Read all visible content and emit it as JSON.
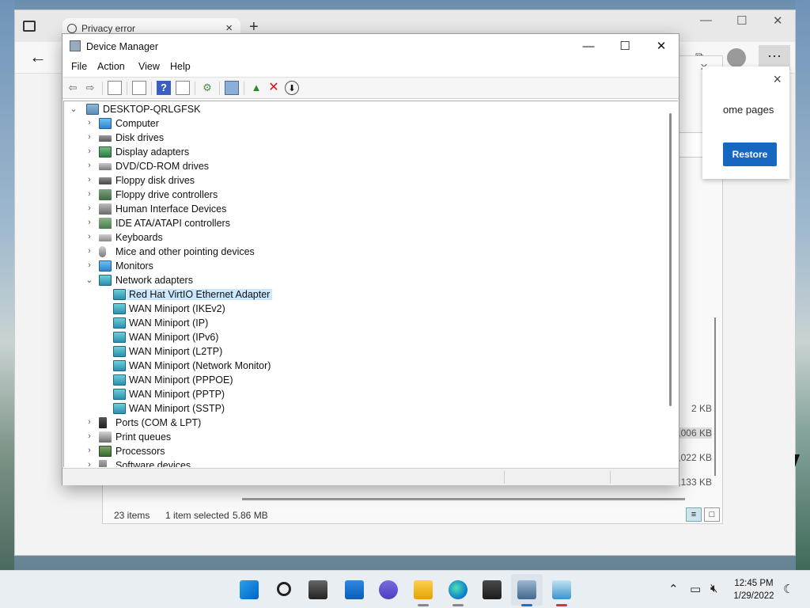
{
  "browser": {
    "tab_title": "Privacy error",
    "tab_close": "×",
    "new_tab": "+",
    "restore_text": "ome pages",
    "restore_button": "Restore",
    "close": "×",
    "more": "···"
  },
  "downloads": {
    "sizes": [
      "2 KB",
      ",006 KB",
      ",022 KB",
      ",133 KB"
    ],
    "status": {
      "items": "23 items",
      "selected": "1 item selected",
      "size": "5.86 MB"
    }
  },
  "device_manager": {
    "title": "Device Manager",
    "controls": {
      "minimize": "—",
      "maximize": "☐",
      "close": "✕"
    },
    "menu": [
      "File",
      "Action",
      "View",
      "Help"
    ],
    "root": "DESKTOP-QRLGFSK",
    "categories": [
      {
        "label": "Computer",
        "icon": "computer-icon"
      },
      {
        "label": "Disk drives",
        "icon": "disk-drive-icon"
      },
      {
        "label": "Display adapters",
        "icon": "display-adapter-icon"
      },
      {
        "label": "DVD/CD-ROM drives",
        "icon": "dvd-drive-icon"
      },
      {
        "label": "Floppy disk drives",
        "icon": "floppy-disk-icon"
      },
      {
        "label": "Floppy drive controllers",
        "icon": "floppy-controller-icon"
      },
      {
        "label": "Human Interface Devices",
        "icon": "hid-icon"
      },
      {
        "label": "IDE ATA/ATAPI controllers",
        "icon": "ide-controller-icon"
      },
      {
        "label": "Keyboards",
        "icon": "keyboard-icon"
      },
      {
        "label": "Mice and other pointing devices",
        "icon": "mouse-icon"
      },
      {
        "label": "Monitors",
        "icon": "monitor-icon"
      },
      {
        "label": "Network adapters",
        "icon": "network-adapter-icon"
      }
    ],
    "network_children": [
      "Red Hat VirtIO Ethernet Adapter",
      "WAN Miniport (IKEv2)",
      "WAN Miniport (IP)",
      "WAN Miniport (IPv6)",
      "WAN Miniport (L2TP)",
      "WAN Miniport (Network Monitor)",
      "WAN Miniport (PPPOE)",
      "WAN Miniport (PPTP)",
      "WAN Miniport (SSTP)"
    ],
    "after_categories": [
      {
        "label": "Ports (COM & LPT)",
        "icon": "port-icon"
      },
      {
        "label": "Print queues",
        "icon": "printer-icon"
      },
      {
        "label": "Processors",
        "icon": "processor-icon"
      },
      {
        "label": "Software devices",
        "icon": "software-device-icon"
      }
    ],
    "selected": "Red Hat VirtIO Ethernet Adapter"
  },
  "taskbar": {
    "time": "12:45 PM",
    "date": "1/29/2022"
  }
}
